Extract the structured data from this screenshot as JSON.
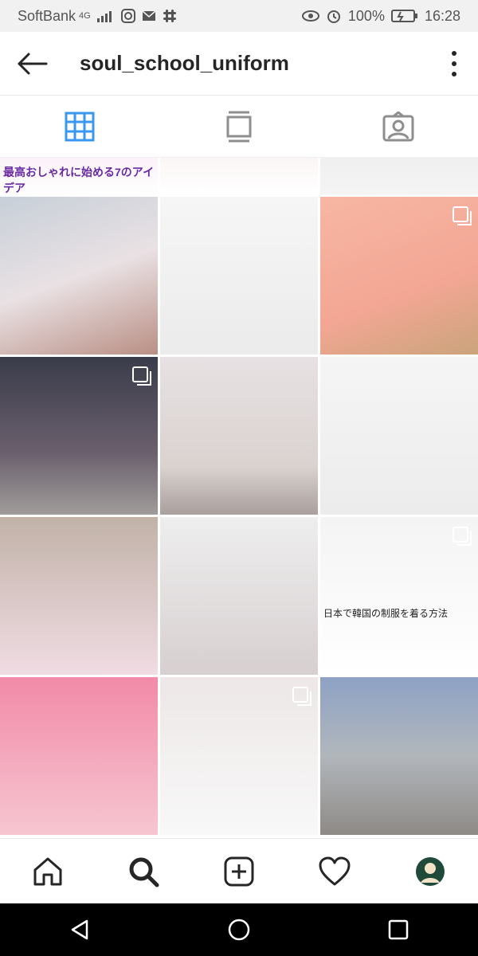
{
  "status_bar": {
    "carrier": "SoftBank",
    "network": "4G",
    "battery_percent": "100%",
    "time": "16:28"
  },
  "header": {
    "title": "soul_school_uniform"
  },
  "tabs": [
    {
      "name": "grid",
      "active": true
    },
    {
      "name": "feed",
      "active": false
    },
    {
      "name": "tagged",
      "active": false
    }
  ],
  "grid": {
    "posts": [
      {
        "caption": "最高おしゃれに始める7のアイデア",
        "multi": false
      },
      {
        "caption": "",
        "multi": false
      },
      {
        "caption": "",
        "multi": false
      },
      {
        "caption": "",
        "multi": false
      },
      {
        "caption": "",
        "multi": false
      },
      {
        "caption": "",
        "multi": true
      },
      {
        "caption": "",
        "multi": true
      },
      {
        "caption": "",
        "multi": false
      },
      {
        "caption": "",
        "multi": false
      },
      {
        "caption": "",
        "multi": false
      },
      {
        "caption": "",
        "multi": false
      },
      {
        "caption": "日本で韓国の制服を着る方法",
        "multi": true
      },
      {
        "caption": "",
        "multi": false
      },
      {
        "caption": "",
        "multi": true
      },
      {
        "caption": "",
        "multi": false
      }
    ]
  },
  "bottom_nav": [
    "home",
    "search",
    "add",
    "activity",
    "profile"
  ],
  "colors": {
    "accent": "#3897f0",
    "text": "#262626"
  }
}
